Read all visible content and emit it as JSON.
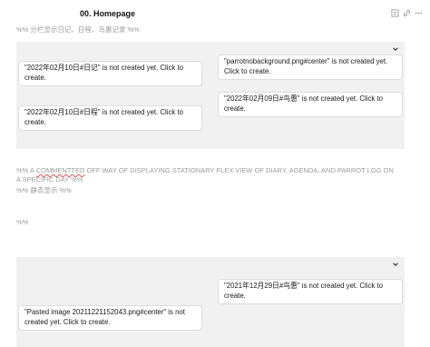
{
  "header": {
    "title": "00. Homepage",
    "icons": [
      "reading-view-icon",
      "link-icon",
      "more-icon"
    ]
  },
  "top_comment": "%% 分栏显示日记、日程、鸟惠记录 %%",
  "panel1": {
    "collapse_icon": "chevron-down-icon",
    "notes": [
      {
        "text": "\"2022年02月10日#日记\" is not created yet. Click to create."
      },
      {
        "text": "\"parrotnobackground.png#center\" is not created yet. Click to create."
      },
      {
        "text": "\"2022年02月09日#鸟惠\" is not created yet. Click to create."
      },
      {
        "text": "\"2022年02月10日#日程\" is not created yet. Click to create."
      }
    ]
  },
  "middle_comment": {
    "prefix": "%% A ",
    "misspelled": "COMMENTTED",
    "suffix": " OFF WAY OF DISPLAYING STATIONARY FLEX VIEW OF DIARY, AGENDA, AND PARROT LOG ON A SPECIFIC DAY %%",
    "line2": "%% 静态显示 %%",
    "line3": "%%"
  },
  "panel2": {
    "collapse_icon": "chevron-down-icon",
    "notes": [
      {
        "text": "\"2021年12月29日#鸟惠\" is not created yet. Click to create."
      },
      {
        "text": "\"Pasted image 20211221152043.png#center\" is not created yet. Click to create."
      }
    ]
  }
}
